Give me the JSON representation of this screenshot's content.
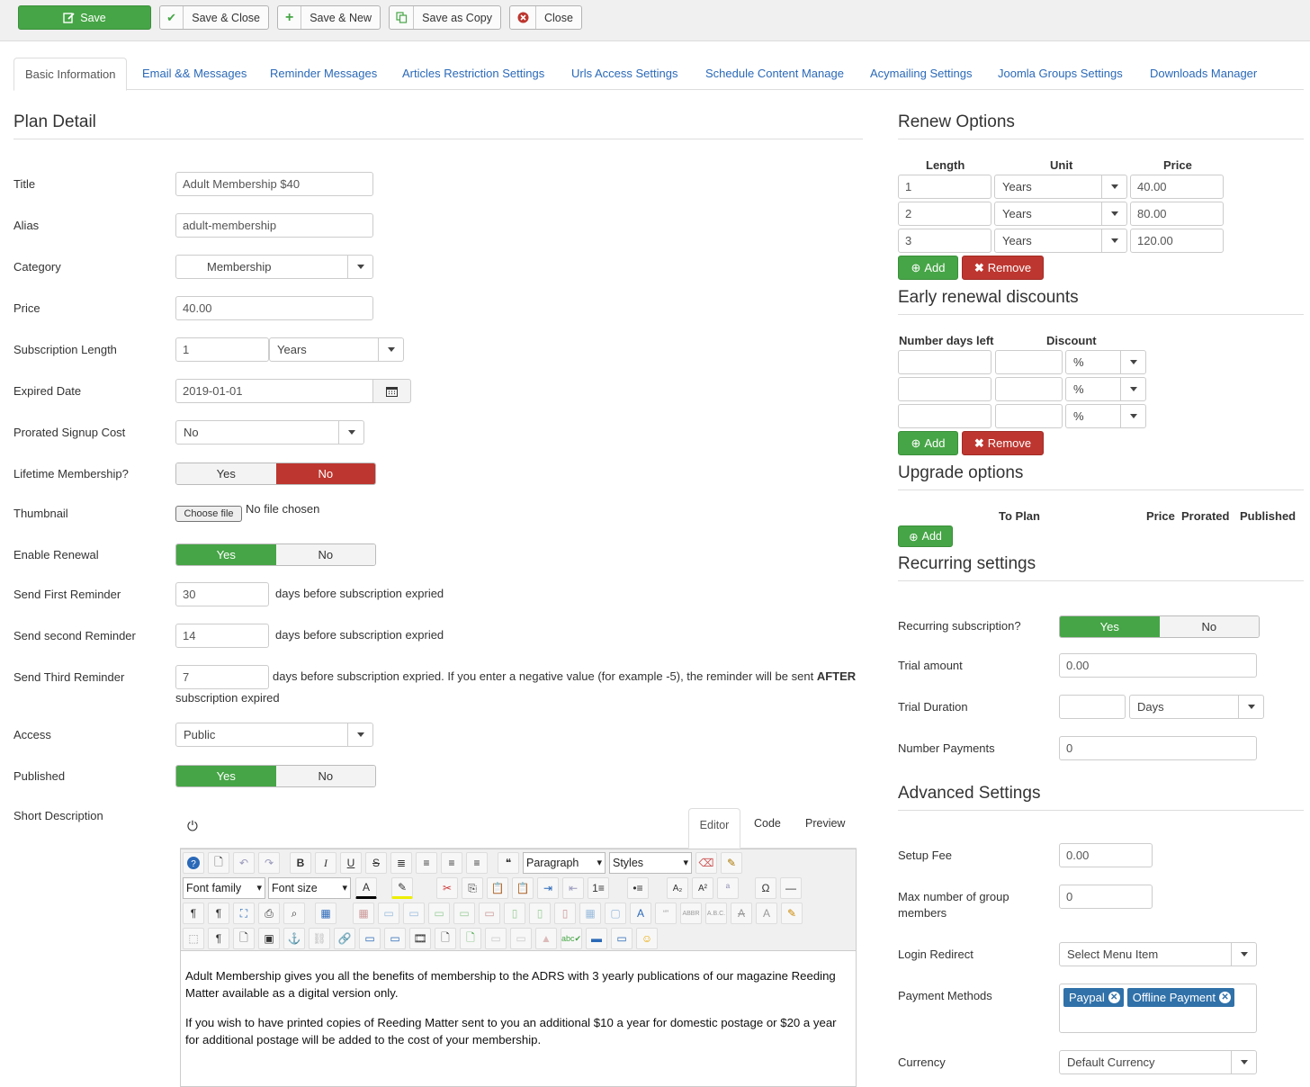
{
  "toolbar": {
    "save": "Save",
    "save_close": "Save & Close",
    "save_new": "Save & New",
    "save_copy": "Save as Copy",
    "close": "Close"
  },
  "tabs": [
    "Basic Information",
    "Email && Messages",
    "Reminder Messages",
    "Articles Restriction Settings",
    "Urls Access Settings",
    "Schedule Content Manage",
    "Acymailing Settings",
    "Joomla Groups Settings",
    "Downloads Manager"
  ],
  "plan": {
    "heading": "Plan Detail",
    "title_label": "Title",
    "title_value": "Adult Membership $40",
    "alias_label": "Alias",
    "alias_value": "adult-membership",
    "category_label": "Category",
    "category_value": "Membership",
    "price_label": "Price",
    "price_value": "40.00",
    "sublen_label": "Subscription Length",
    "sublen_value": "1",
    "sublen_unit": "Years",
    "expired_label": "Expired Date",
    "expired_value": "2019-01-01",
    "prorated_label": "Prorated Signup Cost",
    "prorated_value": "No",
    "lifetime_label": "Lifetime Membership?",
    "thumb_label": "Thumbnail",
    "thumb_btn": "Choose file",
    "thumb_status": "No file chosen",
    "renewal_label": "Enable Renewal",
    "first_label": "Send First Reminder",
    "first_value": "30",
    "second_label": "Send second Reminder",
    "second_value": "14",
    "third_label": "Send Third Reminder",
    "third_value": "7",
    "days_before": "days before subscription expried",
    "third_note_a": "days before subscription expried. If you enter a negative value (for example -5), the reminder will be sent ",
    "third_note_b": "AFTER",
    "third_note_c": "subscription expired",
    "access_label": "Access",
    "access_value": "Public",
    "published_label": "Published",
    "shortdesc_label": "Short Description",
    "yes": "Yes",
    "no": "No"
  },
  "editor": {
    "tab_editor": "Editor",
    "tab_code": "Code",
    "tab_preview": "Preview",
    "paragraph": "Paragraph",
    "styles": "Styles",
    "font_family": "Font family",
    "font_size": "Font size",
    "p1": "Adult Membership gives you all the benefits of membership to the ADRS with 3 yearly publications of our magazine Reeding Matter available as a digital version only.",
    "p2": "If you wish to have printed copies of Reeding Matter sent to you an additional $10 a year for domestic postage or $20 a year for additional postage will be added to the cost of your membership."
  },
  "renew": {
    "heading": "Renew Options",
    "col_length": "Length",
    "col_unit": "Unit",
    "col_price": "Price",
    "rows": [
      {
        "length": "1",
        "unit": "Years",
        "price": "40.00"
      },
      {
        "length": "2",
        "unit": "Years",
        "price": "80.00"
      },
      {
        "length": "3",
        "unit": "Years",
        "price": "120.00"
      }
    ],
    "add": "Add",
    "remove": "Remove"
  },
  "early": {
    "heading": "Early renewal discounts",
    "col_days": "Number days left",
    "col_discount": "Discount",
    "unit": "%",
    "add": "Add",
    "remove": "Remove"
  },
  "upgrade": {
    "heading": "Upgrade options",
    "col_to_plan": "To Plan",
    "col_price": "Price",
    "col_prorated": "Prorated",
    "col_published": "Published",
    "add": "Add"
  },
  "recurring": {
    "heading": "Recurring settings",
    "recurring_label": "Recurring subscription?",
    "trial_amount_label": "Trial amount",
    "trial_amount_value": "0.00",
    "trial_duration_label": "Trial Duration",
    "trial_duration_unit": "Days",
    "num_payments_label": "Number Payments",
    "num_payments_value": "0",
    "yes": "Yes",
    "no": "No"
  },
  "advanced": {
    "heading": "Advanced Settings",
    "setup_fee_label": "Setup Fee",
    "setup_fee_value": "0.00",
    "max_group_label_1": "Max number of group",
    "max_group_label_2": "members",
    "max_group_value": "0",
    "login_redirect_label": "Login Redirect",
    "login_redirect_value": "Select Menu Item",
    "payment_methods_label": "Payment Methods",
    "payment_methods": [
      "Paypal",
      "Offline Payment"
    ],
    "currency_label": "Currency",
    "currency_value": "Default Currency"
  },
  "colors": {
    "green": "#46a546",
    "red": "#bd362f",
    "link": "#2a69b8",
    "chip": "#3071a9"
  }
}
